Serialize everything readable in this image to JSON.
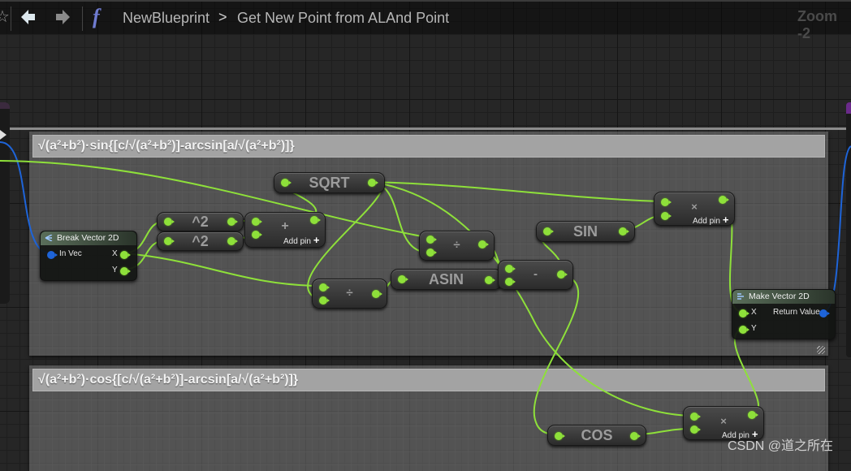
{
  "toolbar": {
    "favorite_icon": "star-icon",
    "back_icon": "back-arrow-icon",
    "forward_icon": "forward-arrow-icon",
    "function_icon": "f",
    "breadcrumb": [
      "NewBlueprint",
      "Get New Point from ALAnd Point"
    ],
    "breadcrumb_separator": ">",
    "zoom_label": "Zoom -2"
  },
  "comments": [
    {
      "title": "√(a²+b²)·sin{[c/√(a²+b²)]-arcsin[a/√(a²+b²)]}"
    },
    {
      "title": "√(a²+b²)·cos{[c/√(a²+b²)]-arcsin[a/√(a²+b²)]}"
    }
  ],
  "nodes": {
    "break_vector": {
      "title": "Break Vector 2D",
      "input": "In Vec",
      "out_x": "X",
      "out_y": "Y"
    },
    "square_1": {
      "label": "^2"
    },
    "square_2": {
      "label": "^2"
    },
    "add": {
      "symbol": "+",
      "add_pin": "Add pin",
      "add_pin_icon": "+"
    },
    "sqrt": {
      "label": "SQRT"
    },
    "divide_1": {
      "symbol": "÷"
    },
    "divide_2": {
      "symbol": "÷"
    },
    "asin": {
      "label": "ASIN"
    },
    "subtract": {
      "symbol": "-"
    },
    "sin": {
      "label": "SIN"
    },
    "multiply_1": {
      "symbol": "×",
      "add_pin": "Add pin",
      "add_pin_icon": "+"
    },
    "make_vector": {
      "title": "Make Vector 2D",
      "in_x": "X",
      "in_y": "Y",
      "output": "Return Value"
    },
    "cos": {
      "label": "COS"
    },
    "multiply_2": {
      "symbol": "×",
      "add_pin": "Add pin",
      "add_pin_icon": "+"
    }
  },
  "colors": {
    "float_pin": "#8ee03a",
    "vector_pin": "#1e64d8",
    "function_icon": "#6f7bd0"
  },
  "watermark": "CSDN @道之所在"
}
